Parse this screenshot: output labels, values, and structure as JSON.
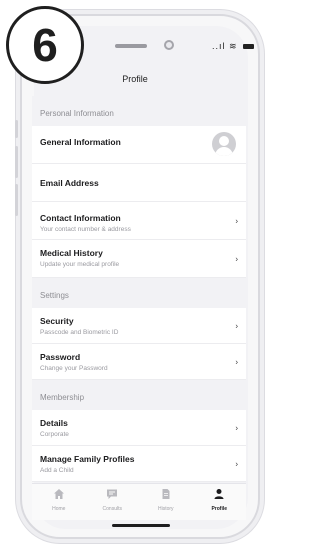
{
  "badge": {
    "number": "6"
  },
  "status_bar": {
    "signal": "..ıl",
    "wifi": "≋"
  },
  "header": {
    "title": "Profile"
  },
  "sections": {
    "personal": {
      "heading": "Personal Information",
      "general": {
        "label": "General Information"
      },
      "email": {
        "label": "Email Address"
      },
      "contact": {
        "label": "Contact Information",
        "sub": "Your contact number & address"
      },
      "medical": {
        "label": "Medical History",
        "sub": "Update your medical profile"
      }
    },
    "settings": {
      "heading": "Settings",
      "security": {
        "label": "Security",
        "sub": "Passcode and Biometric ID"
      },
      "password": {
        "label": "Password",
        "sub": "Change your Password"
      }
    },
    "membership": {
      "heading": "Membership",
      "details": {
        "label": "Details",
        "sub": "Corporate"
      },
      "family": {
        "label": "Manage Family Profiles",
        "sub": "Add a Child"
      }
    }
  },
  "chevron": "›",
  "tabs": [
    {
      "label": "Home",
      "icon": "home-icon"
    },
    {
      "label": "Consults",
      "icon": "chat-icon"
    },
    {
      "label": "History",
      "icon": "document-icon"
    },
    {
      "label": "Profile",
      "icon": "person-icon"
    }
  ]
}
